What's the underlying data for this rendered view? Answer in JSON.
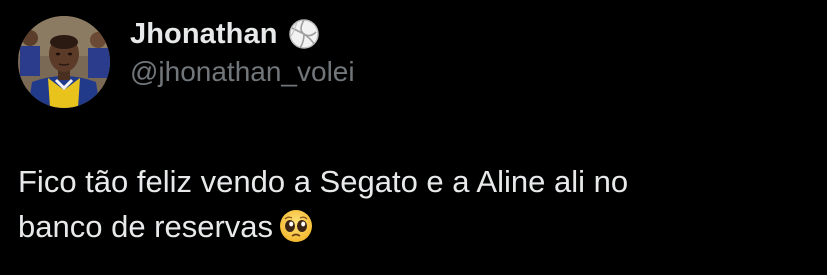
{
  "author": {
    "display_name": "Jhonathan",
    "handle": "@jhonathan_volei",
    "badge_icon": "volleyball-icon",
    "avatar_icon": "profile-photo"
  },
  "tweet": {
    "line1": "Fico tão feliz vendo a Segato e a Aline ali no",
    "line2": "banco de reservas",
    "emoji_icon": "pleading-face-emoji"
  },
  "colors": {
    "background": "#000000",
    "primary_text": "#e7e9ea",
    "secondary_text": "#71767b"
  }
}
